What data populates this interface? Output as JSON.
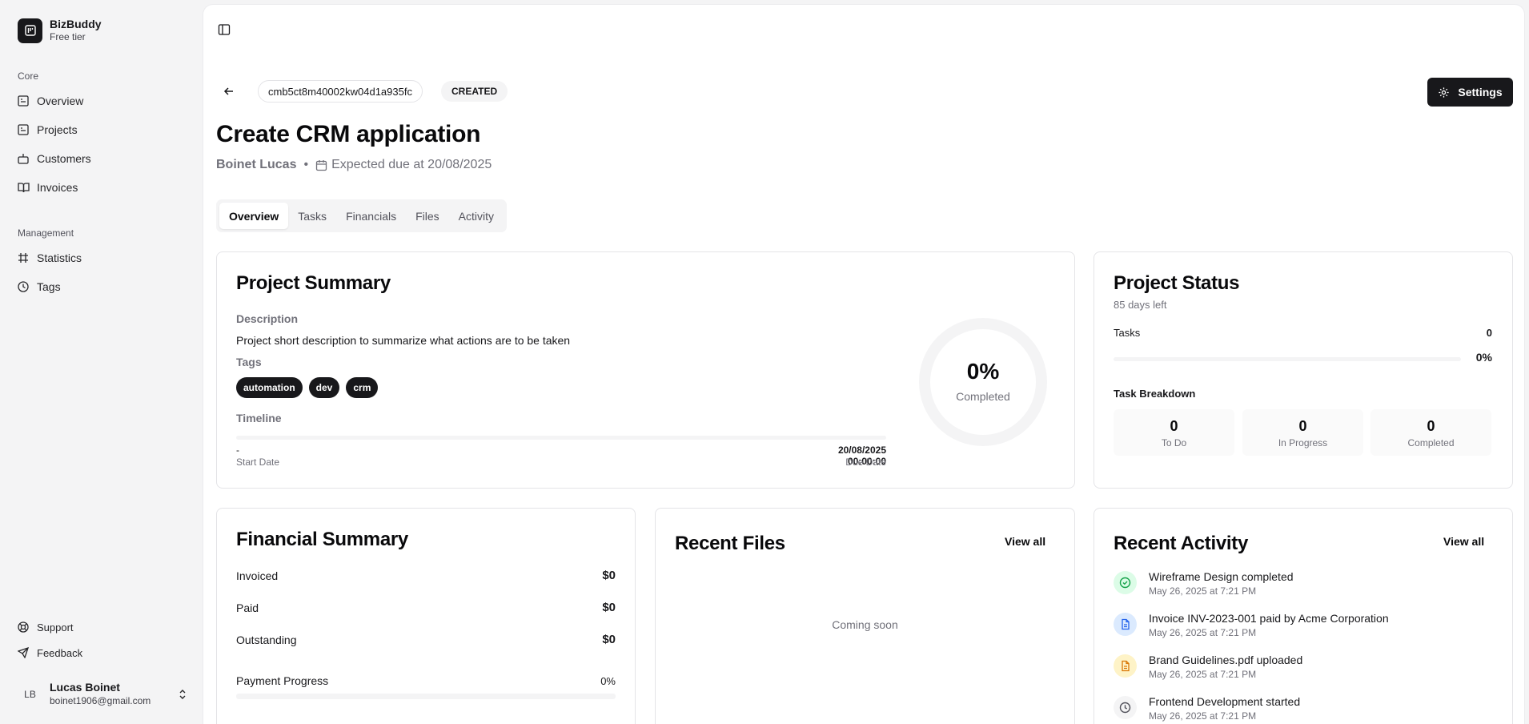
{
  "brand": {
    "name": "BizBuddy",
    "tier": "Free tier"
  },
  "sidebar": {
    "groups": [
      {
        "label": "Core",
        "items": [
          {
            "label": "Overview",
            "icon": "overview-icon"
          },
          {
            "label": "Projects",
            "icon": "projects-icon"
          },
          {
            "label": "Customers",
            "icon": "customers-icon"
          },
          {
            "label": "Invoices",
            "icon": "invoices-icon"
          }
        ]
      },
      {
        "label": "Management",
        "items": [
          {
            "label": "Statistics",
            "icon": "hash-icon"
          },
          {
            "label": "Tags",
            "icon": "tags-icon"
          }
        ]
      }
    ],
    "footer_items": [
      {
        "label": "Support",
        "icon": "lifebuoy-icon"
      },
      {
        "label": "Feedback",
        "icon": "send-icon"
      }
    ],
    "user": {
      "initials": "LB",
      "name": "Lucas Boinet",
      "email": "boinet1906@gmail.com"
    }
  },
  "header": {
    "project_id": "cmb5ct8m40002kw04d1a935fc",
    "status": "CREATED",
    "settings_label": "Settings",
    "title": "Create CRM application",
    "owner": "Boinet Lucas",
    "due_text": "Expected due at 20/08/2025"
  },
  "tabs": [
    {
      "label": "Overview",
      "active": true
    },
    {
      "label": "Tasks",
      "active": false
    },
    {
      "label": "Financials",
      "active": false
    },
    {
      "label": "Files",
      "active": false
    },
    {
      "label": "Activity",
      "active": false
    }
  ],
  "project_summary": {
    "title": "Project Summary",
    "description_label": "Description",
    "description": "Project short description to summarize what actions are to be taken",
    "tags_label": "Tags",
    "tags": [
      "automation",
      "dev",
      "crm"
    ],
    "timeline_label": "Timeline",
    "start_value": "-",
    "start_caption": "Start Date",
    "due_value": "20/08/2025 00:00:00",
    "due_caption": "Due Date",
    "timeline_progress": 0,
    "completion_percent": "0%",
    "completion_caption": "Completed"
  },
  "project_status": {
    "title": "Project Status",
    "days_left": "85 days left",
    "tasks_label": "Tasks",
    "tasks_count": "0",
    "tasks_percent": "0%",
    "tasks_progress": 0,
    "breakdown_label": "Task Breakdown",
    "breakdown": [
      {
        "value": "0",
        "caption": "To Do"
      },
      {
        "value": "0",
        "caption": "In Progress"
      },
      {
        "value": "0",
        "caption": "Completed"
      }
    ]
  },
  "financial_summary": {
    "title": "Financial Summary",
    "rows": [
      {
        "label": "Invoiced",
        "value": "$0"
      },
      {
        "label": "Paid",
        "value": "$0"
      },
      {
        "label": "Outstanding",
        "value": "$0"
      }
    ],
    "payment_label": "Payment Progress",
    "payment_percent": "0%",
    "payment_progress": 0
  },
  "recent_files": {
    "title": "Recent Files",
    "view_all": "View all",
    "placeholder": "Coming soon"
  },
  "recent_activity": {
    "title": "Recent Activity",
    "view_all": "View all",
    "items": [
      {
        "title": "Wireframe Design completed",
        "time": "May 26, 2025 at 7:21 PM",
        "icon": "check-circle-icon",
        "color": "#16a34a",
        "bg": "#dcfce7"
      },
      {
        "title": "Invoice INV-2023-001 paid by Acme Corporation",
        "time": "May 26, 2025 at 7:21 PM",
        "icon": "document-icon",
        "color": "#2563eb",
        "bg": "#dbeafe"
      },
      {
        "title": "Brand Guidelines.pdf uploaded",
        "time": "May 26, 2025 at 7:21 PM",
        "icon": "file-icon",
        "color": "#d97706",
        "bg": "#fef3c7"
      },
      {
        "title": "Frontend Development started",
        "time": "May 26, 2025 at 7:21 PM",
        "icon": "clock-icon",
        "color": "#52525b",
        "bg": "#f4f4f5"
      }
    ]
  }
}
